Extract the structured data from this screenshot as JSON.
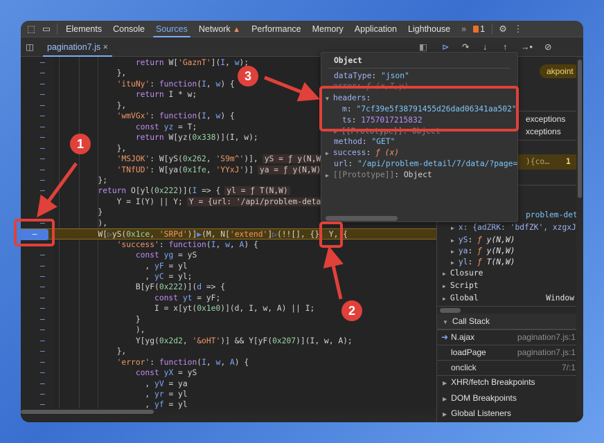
{
  "toolbar": {
    "tabs": [
      {
        "label": "Elements"
      },
      {
        "label": "Console"
      },
      {
        "label": "Sources",
        "active": true
      },
      {
        "label": "Network"
      },
      {
        "label": "Performance"
      },
      {
        "label": "Memory"
      },
      {
        "label": "Application"
      },
      {
        "label": "Lighthouse"
      }
    ],
    "more": "»",
    "issues_count": "1",
    "icons": [
      "inspect-element-icon",
      "device-toolbar-icon",
      "warning-icon",
      "settings-gear-icon",
      "more-vert-icon"
    ]
  },
  "file_tab": {
    "name": "pagination7.js",
    "close": "×"
  },
  "debug_controls": [
    "resume-icon",
    "step-over-icon",
    "step-into-icon",
    "step-out-icon",
    "step-icon",
    "deactivate-breakpoints-icon"
  ],
  "code": {
    "lines": [
      {
        "t": [
          [
            "t",
            "                "
          ],
          [
            "k",
            "return "
          ],
          [
            "t",
            "W["
          ],
          [
            "s",
            "'GaznT'"
          ],
          [
            "t",
            "]("
          ],
          [
            "p",
            "I"
          ],
          [
            "t",
            ", "
          ],
          [
            "p",
            "w"
          ],
          [
            "t",
            ");"
          ]
        ]
      },
      {
        "t": [
          [
            "t",
            "            },"
          ]
        ]
      },
      {
        "t": [
          [
            "t",
            "            "
          ],
          [
            "s",
            "'ituNy'"
          ],
          [
            "t",
            ": "
          ],
          [
            "k",
            "function"
          ],
          [
            "t",
            "("
          ],
          [
            "p",
            "I"
          ],
          [
            "t",
            ", "
          ],
          [
            "p",
            "w"
          ],
          [
            "t",
            ") {"
          ]
        ]
      },
      {
        "t": [
          [
            "t",
            "                "
          ],
          [
            "k",
            "return "
          ],
          [
            "t",
            "I * w;"
          ]
        ]
      },
      {
        "t": [
          [
            "t",
            "            },"
          ]
        ]
      },
      {
        "t": [
          [
            "t",
            "            "
          ],
          [
            "s",
            "'wmVGx'"
          ],
          [
            "t",
            ": "
          ],
          [
            "k",
            "function"
          ],
          [
            "t",
            "("
          ],
          [
            "p",
            "I"
          ],
          [
            "t",
            ", "
          ],
          [
            "p",
            "w"
          ],
          [
            "t",
            ") {"
          ]
        ]
      },
      {
        "t": [
          [
            "t",
            "                "
          ],
          [
            "k",
            "const "
          ],
          [
            "p",
            "yz"
          ],
          [
            "t",
            " = T;"
          ]
        ]
      },
      {
        "t": [
          [
            "t",
            "                "
          ],
          [
            "k",
            "return "
          ],
          [
            "t",
            "W[yz("
          ],
          [
            "n",
            "0x338"
          ],
          [
            "t",
            ")](I, w);"
          ]
        ]
      },
      {
        "t": [
          [
            "t",
            "            },"
          ]
        ]
      },
      {
        "t": [
          [
            "t",
            "            "
          ],
          [
            "s",
            "'MSJOK'"
          ],
          [
            "t",
            ": W[yS("
          ],
          [
            "n",
            "0x262"
          ],
          [
            "t",
            ", "
          ],
          [
            "s",
            "'S9m^'"
          ],
          [
            "t",
            ")],"
          ],
          [
            "v",
            "yS = ƒ y(N,W)"
          ]
        ]
      },
      {
        "t": [
          [
            "t",
            "            "
          ],
          [
            "s",
            "'TNfUD'"
          ],
          [
            "t",
            ": W[ya("
          ],
          [
            "n",
            "0x1fe"
          ],
          [
            "t",
            ", "
          ],
          [
            "s",
            "'YYxJ'"
          ],
          [
            "t",
            ")]"
          ],
          [
            "v",
            "ya = ƒ y(N,W)"
          ]
        ]
      },
      {
        "t": [
          [
            "t",
            "        };"
          ]
        ]
      },
      {
        "t": [
          [
            "t",
            "        "
          ],
          [
            "k",
            "return "
          ],
          [
            "t",
            "O[yl("
          ],
          [
            "n",
            "0x222"
          ],
          [
            "t",
            ")]("
          ],
          [
            "p",
            "I"
          ],
          [
            "t",
            " => {"
          ],
          [
            "v",
            "yl = ƒ T(N,W)"
          ]
        ]
      },
      {
        "t": [
          [
            "t",
            "            Y = I(Y) || Y;"
          ],
          [
            "v",
            "Y = {url: '/api/problem-detai"
          ]
        ]
      },
      {
        "t": [
          [
            "t",
            "        }"
          ]
        ]
      },
      {
        "t": [
          [
            "t",
            "        ),"
          ]
        ]
      },
      {
        "hl": true,
        "t": [
          [
            "t",
            "        W["
          ],
          [
            "bp",
            "▷"
          ],
          [
            "t",
            "yS("
          ],
          [
            "n",
            "0x1ce"
          ],
          [
            "t",
            ", "
          ],
          [
            "s",
            "'SRPd'"
          ],
          [
            "t",
            ")]"
          ],
          [
            "bp",
            "▶"
          ],
          [
            "t",
            "(M, N["
          ],
          [
            "s",
            "'extend'"
          ],
          [
            "t",
            "]"
          ],
          [
            "bp",
            "▷"
          ],
          [
            "t",
            "(!![], {}, Y, {"
          ]
        ]
      },
      {
        "t": [
          [
            "t",
            "            "
          ],
          [
            "s",
            "'success'"
          ],
          [
            "t",
            ": "
          ],
          [
            "k",
            "function"
          ],
          [
            "t",
            "("
          ],
          [
            "p",
            "I"
          ],
          [
            "t",
            ", "
          ],
          [
            "p",
            "w"
          ],
          [
            "t",
            ", "
          ],
          [
            "p",
            "A"
          ],
          [
            "t",
            ") {"
          ]
        ]
      },
      {
        "t": [
          [
            "t",
            "                "
          ],
          [
            "k",
            "const "
          ],
          [
            "p",
            "yg"
          ],
          [
            "t",
            " = yS"
          ]
        ]
      },
      {
        "t": [
          [
            "t",
            "                  , "
          ],
          [
            "p",
            "yF"
          ],
          [
            "t",
            " = yl"
          ]
        ]
      },
      {
        "t": [
          [
            "t",
            "                  , "
          ],
          [
            "p",
            "yC"
          ],
          [
            "t",
            " = yl;"
          ]
        ]
      },
      {
        "t": [
          [
            "t",
            "                B[yF("
          ],
          [
            "n",
            "0x222"
          ],
          [
            "t",
            ")]("
          ],
          [
            "p",
            "d"
          ],
          [
            "t",
            " => {"
          ]
        ]
      },
      {
        "t": [
          [
            "t",
            "                    "
          ],
          [
            "k",
            "const "
          ],
          [
            "p",
            "yt"
          ],
          [
            "t",
            " = yF;"
          ]
        ]
      },
      {
        "t": [
          [
            "t",
            "                    I = x[yt("
          ],
          [
            "n",
            "0x1e0"
          ],
          [
            "t",
            ")](d, I, w, A) || I;"
          ]
        ]
      },
      {
        "t": [
          [
            "t",
            "                }"
          ]
        ]
      },
      {
        "t": [
          [
            "t",
            "                ),"
          ]
        ]
      },
      {
        "t": [
          [
            "t",
            "                Y[yg("
          ],
          [
            "n",
            "0x2d2"
          ],
          [
            "t",
            ", "
          ],
          [
            "s",
            "'&oHT'"
          ],
          [
            "t",
            ")] && Y[yF("
          ],
          [
            "n",
            "0x207"
          ],
          [
            "t",
            ")](I, w, A);"
          ]
        ]
      },
      {
        "t": [
          [
            "t",
            "            },"
          ]
        ]
      },
      {
        "t": [
          [
            "t",
            "            "
          ],
          [
            "s",
            "'error'"
          ],
          [
            "t",
            ": "
          ],
          [
            "k",
            "function"
          ],
          [
            "t",
            "("
          ],
          [
            "p",
            "I"
          ],
          [
            "t",
            ", "
          ],
          [
            "p",
            "w"
          ],
          [
            "t",
            ", "
          ],
          [
            "p",
            "A"
          ],
          [
            "t",
            ") {"
          ]
        ]
      },
      {
        "t": [
          [
            "t",
            "                "
          ],
          [
            "k",
            "const "
          ],
          [
            "p",
            "yX"
          ],
          [
            "t",
            " = yS"
          ]
        ]
      },
      {
        "t": [
          [
            "t",
            "                  , "
          ],
          [
            "p",
            "yV"
          ],
          [
            "t",
            " = ya"
          ]
        ]
      },
      {
        "t": [
          [
            "t",
            "                  , "
          ],
          [
            "p",
            "yr"
          ],
          [
            "t",
            " = yl"
          ]
        ]
      },
      {
        "t": [
          [
            "t",
            "                  , "
          ],
          [
            "p",
            "yf"
          ],
          [
            "t",
            " = yl"
          ]
        ]
      }
    ],
    "gutter_mark": "–"
  },
  "popup": {
    "title": "Object",
    "rows": {
      "dataType_key": "dataType",
      "dataType_val": "\"json\"",
      "error_key": "error",
      "error_val": "ƒ (x,T,y)",
      "headers_key": "headers",
      "m_key": "m",
      "m_val": "\"7cf39e5f38791455d26dad06341aa502\"",
      "ts_key": "ts",
      "ts_val": "1757017215832",
      "proto_inner": "[[Prototype]]: Object",
      "method_key": "method",
      "method_val": "\"GET\"",
      "success_key": "success",
      "success_val": "ƒ (x)",
      "url_key": "url",
      "url_val": "\"/api/problem-detail/7/data/?page=4(",
      "proto": "[[Prototype]]",
      "proto_val": "Object"
    }
  },
  "right_panel": {
    "paused_pill": "akpoint",
    "exc1": "exceptions",
    "exc2": "xceptions",
    "bp_code": "){co…",
    "bp_line": "1",
    "scope_frag": "problem-det",
    "scope_x": "x: {adZRK: 'bdfZK', xzgxJ:",
    "scope_items": [
      {
        "k": "yS",
        "v": "ƒ",
        "s": "y(N,W)"
      },
      {
        "k": "ya",
        "v": "ƒ",
        "s": "y(N,W)"
      },
      {
        "k": "yl",
        "v": "ƒ",
        "s": "T(N,W)"
      }
    ],
    "closure": "Closure",
    "script": "Script",
    "global": "Global",
    "global_val": "Window",
    "call_stack": "Call Stack",
    "frames": [
      {
        "name": "N.ajax",
        "loc": "pagination7.js:1",
        "current": true
      },
      {
        "name": "loadPage",
        "loc": "pagination7.js:1"
      },
      {
        "name": "onclick",
        "loc": "7/:1"
      }
    ],
    "xhr": "XHR/fetch Breakpoints",
    "dom": "DOM Breakpoints",
    "listeners": "Global Listeners"
  },
  "annotations": {
    "labels": [
      "1",
      "2",
      "3"
    ],
    "color": "#e0413a"
  },
  "colors": {
    "accent": "#7cacf8",
    "highlight_line": "#4a3b12",
    "annotation": "#e0413a"
  }
}
